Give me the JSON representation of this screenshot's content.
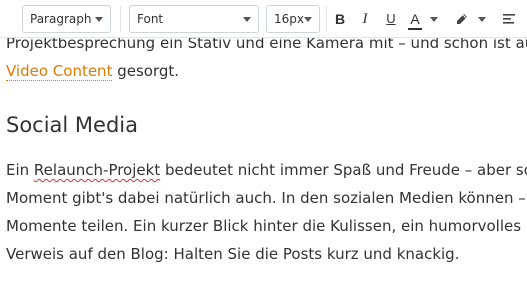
{
  "toolbar": {
    "paragraph_select": "Paragraph",
    "font_select": "Font",
    "size_select": "16px",
    "bold_label": "B",
    "italic_label": "I",
    "underline_label": "U",
    "text_color_label": "A",
    "icons": [
      "bold-icon",
      "italic-icon",
      "underline-icon",
      "text-color-icon",
      "highlight-icon",
      "align-icon"
    ]
  },
  "content": {
    "partial_line": "Projektbesprechung ein Stativ und eine Kamera mit – und schon ist aus",
    "video_link": "Video Content",
    "video_rest": " gesorgt.",
    "heading": "Social Media",
    "p1_a": "Ein ",
    "p1_spell": "Relaunch-Projekt",
    "p1_b": " bedeutet nicht immer Spaß und Freude – aber so",
    "p2": "Moment gibt's dabei natürlich auch. In den sozialen Medien können – u",
    "p3": "Momente teilen. Ein kurzer Blick hinter die Kulissen, ein humorvolles Fo",
    "p4": "Verweis auf den Blog: Halten Sie die Posts kurz und knackig."
  }
}
